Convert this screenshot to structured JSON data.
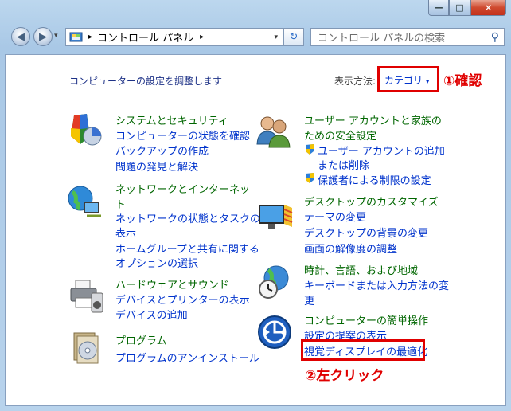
{
  "window": {
    "minimize_glyph": "—",
    "maximize_glyph": "□",
    "close_glyph": "✕"
  },
  "nav": {
    "back_glyph": "◀",
    "forward_glyph": "▶",
    "breadcrumb_sep": "▸",
    "address_label": "コントロール パネル",
    "address_trailing": "▸",
    "dropdown_glyph": "▾",
    "refresh_glyph": "↻",
    "search_placeholder": "コントロール パネルの検索",
    "search_glyph": "⚲"
  },
  "page": {
    "title": "コンピューターの設定を調整します",
    "view_label": "表示方法:",
    "view_value": "カテゴリ",
    "view_dropdown": "▾"
  },
  "annotations": {
    "step1": "①確認",
    "step2": "②左クリック"
  },
  "categories": {
    "system": {
      "heading": "システムとセキュリティ",
      "links": [
        "コンピューターの状態を確認",
        "バックアップの作成",
        "問題の発見と解決"
      ]
    },
    "network": {
      "heading1": "ネットワークとインターネッ",
      "heading2": "ト",
      "link1a": "ネットワークの状態とタスクの",
      "link1b": "表示",
      "link2a": "ホームグループと共有に関する",
      "link2b": "オプションの選択"
    },
    "hardware": {
      "heading": "ハードウェアとサウンド",
      "links": [
        "デバイスとプリンターの表示",
        "デバイスの追加"
      ]
    },
    "programs": {
      "heading": "プログラム",
      "links": [
        "プログラムのアンインストール"
      ]
    },
    "users": {
      "heading1": "ユーザー アカウントと家族の",
      "heading2": "ための安全設定",
      "link1a": "ユーザー アカウントの追加",
      "link1b": "または削除",
      "link2": "保護者による制限の設定"
    },
    "appearance": {
      "heading": "デスクトップのカスタマイズ",
      "links": [
        "テーマの変更",
        "デスクトップの背景の変更",
        "画面の解像度の調整"
      ]
    },
    "clock": {
      "heading": "時計、言語、および地域",
      "link1a": "キーボードまたは入力方法の変",
      "link1b": "更"
    },
    "ease": {
      "heading": "コンピューターの簡単操作",
      "link1": "設定の提案の表示",
      "link2": "視覚ディスプレイの最適化"
    }
  },
  "colors": {
    "link": "#0033cc",
    "heading": "#006600",
    "annotation": "#e00000"
  }
}
